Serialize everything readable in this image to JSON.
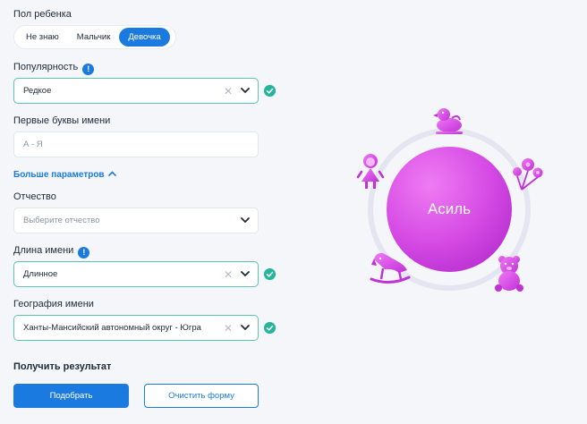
{
  "gender": {
    "label": "Пол ребенка",
    "options": [
      "Не знаю",
      "Мальчик",
      "Девочка"
    ],
    "selected": "Девочка"
  },
  "popularity": {
    "label": "Популярность",
    "value": "Редкое"
  },
  "first_letters": {
    "label": "Первые буквы имени",
    "placeholder": "А - Я"
  },
  "more_params": {
    "label": "Больше параметров"
  },
  "patronymic": {
    "label": "Отчество",
    "placeholder": "Выберите отчество"
  },
  "name_length": {
    "label": "Длина имени",
    "value": "Длинное"
  },
  "geography": {
    "label": "География имени",
    "value": "Ханты-Мансийский автономный округ - Югра"
  },
  "result": {
    "title": "Получить результат",
    "submit_label": "Подобрать",
    "clear_label": "Очистить форму",
    "name": "Асиль"
  },
  "icons": [
    "info-icon",
    "chevron-down-icon",
    "clear-icon",
    "check-icon",
    "chevron-up-icon",
    "duck-icon",
    "doll-icon",
    "flowers-icon",
    "rocking-horse-icon",
    "teddy-bear-icon"
  ],
  "colors": {
    "accent": "#1b7ae0",
    "valid": "#26b59b",
    "circle": "#d14be0"
  }
}
